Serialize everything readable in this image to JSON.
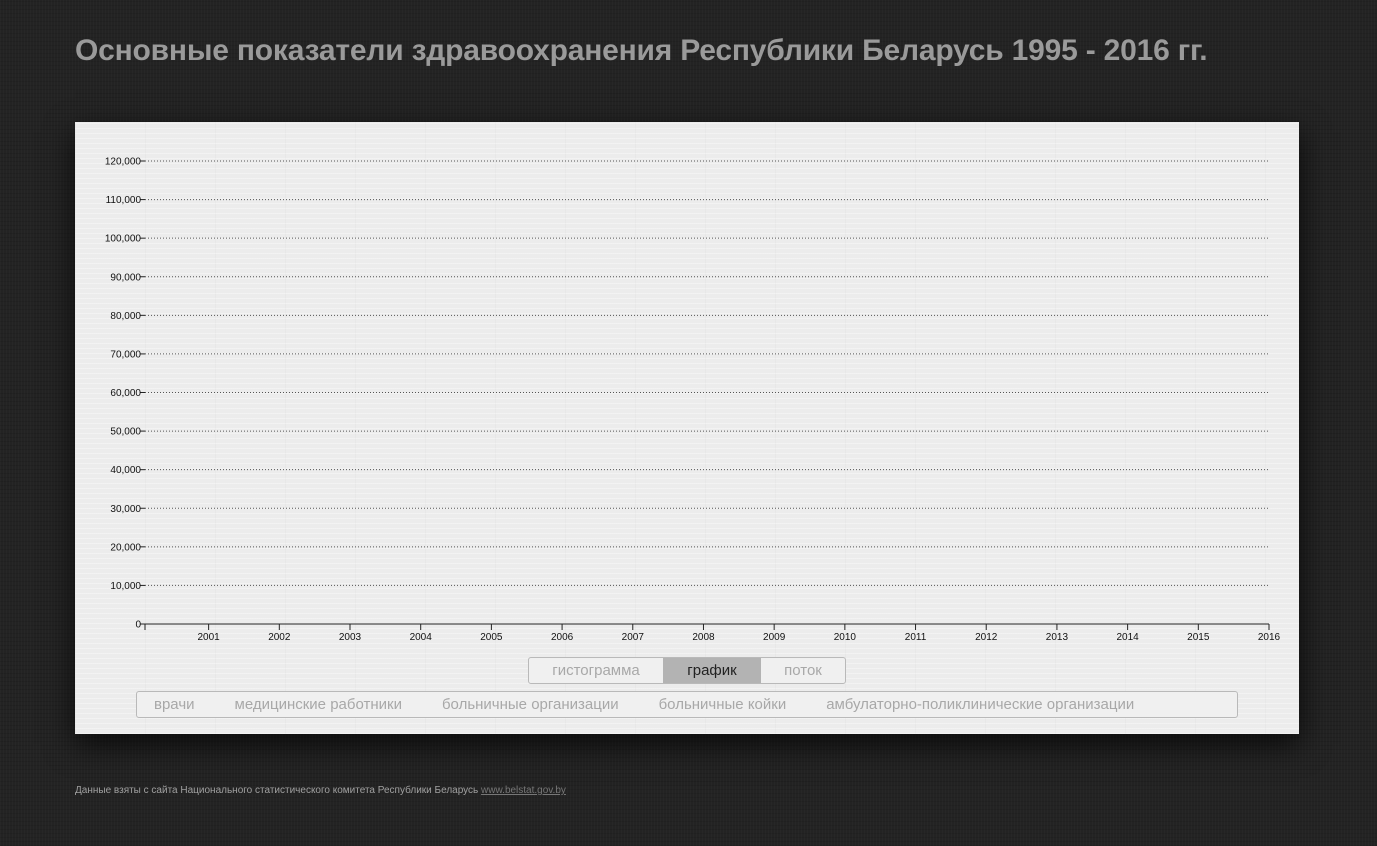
{
  "page": {
    "title": "Основные показатели здравоохранения Республики Беларусь 1995 - 2016 гг."
  },
  "chart_data": {
    "type": "line",
    "x": [
      "2001",
      "2002",
      "2003",
      "2004",
      "2005",
      "2006",
      "2007",
      "2008",
      "2009",
      "2010",
      "2011",
      "2012",
      "2013",
      "2014",
      "2015",
      "2016"
    ],
    "xlim": [
      2000.1,
      2016
    ],
    "ylim": [
      0,
      120000
    ],
    "y_ticks": [
      0,
      10000,
      20000,
      30000,
      40000,
      50000,
      60000,
      70000,
      80000,
      90000,
      100000,
      110000,
      120000
    ],
    "y_tick_labels": [
      "0",
      "10,000",
      "20,000",
      "30,000",
      "40,000",
      "50,000",
      "60,000",
      "70,000",
      "80,000",
      "90,000",
      "100,000",
      "110,000",
      "120,000"
    ],
    "grid": true,
    "series": []
  },
  "chart_type_tabs": [
    {
      "label": "гистограмма",
      "active": false
    },
    {
      "label": "график",
      "active": true
    },
    {
      "label": "поток",
      "active": false
    }
  ],
  "metric_tabs": [
    {
      "label": "врачи"
    },
    {
      "label": "медицинские работники"
    },
    {
      "label": "больничные организации"
    },
    {
      "label": "больничные койки"
    },
    {
      "label": "амбулаторно-поликлинические организации"
    }
  ],
  "footer": {
    "text": "Данные взяты с сайта Национального статистического комитета Республики Беларусь",
    "link_text": "www.belstat.gov.by"
  },
  "colors": {
    "background": "#232323",
    "panel": "#ececec",
    "title": "#9a9a9a",
    "active_tab": "#b3b3b3"
  }
}
